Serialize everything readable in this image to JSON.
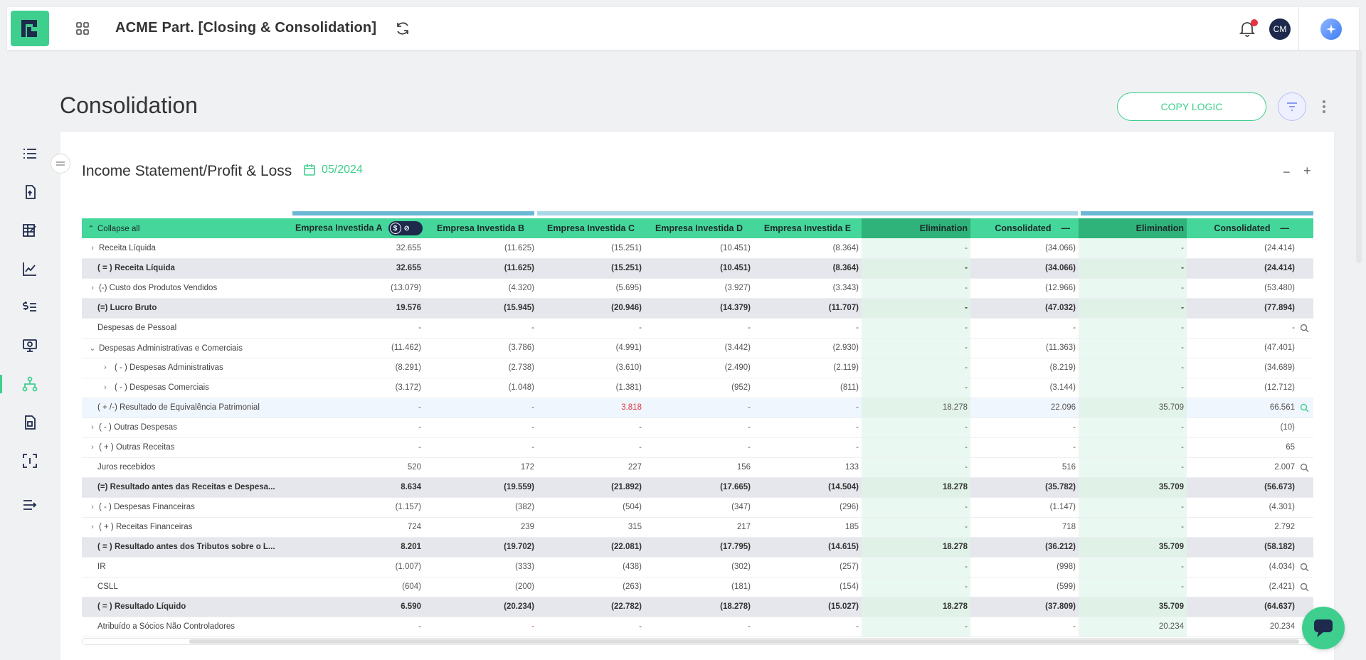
{
  "app": {
    "title": "ACME Part. [Closing & Consolidation]",
    "user_initials": "CM"
  },
  "page": {
    "title": "Consolidation",
    "copy_logic_label": "COPY LOGIC"
  },
  "report": {
    "title": "Income Statement/Profit & Loss",
    "period": "05/2024",
    "collapse_all_label": "Collapse all"
  },
  "colors": {
    "accent": "#3ecf8e",
    "header_bg": "#44d69a",
    "elimination_bg": "#e9f8f0",
    "subtotal_bg": "#e5e7ec",
    "negative": "#e5333f"
  },
  "columns": [
    "Empresa Investida A",
    "Empresa Investida B",
    "Empresa Investida C",
    "Empresa Investida D",
    "Empresa Investida E",
    "Elimination",
    "Consolidated",
    "Elimination",
    "Consolidated"
  ],
  "rows": [
    {
      "label": "Receita Líquida",
      "values": [
        "32.655",
        "(11.625)",
        "(15.251)",
        "(10.451)",
        "(8.364)",
        "-",
        "(34.066)",
        "-",
        "(24.414)"
      ]
    },
    {
      "label": "( = ) Receita Líquida",
      "values": [
        "32.655",
        "(11.625)",
        "(15.251)",
        "(10.451)",
        "(8.364)",
        "-",
        "(34.066)",
        "-",
        "(24.414)"
      ]
    },
    {
      "label": "(-) Custo dos Produtos Vendidos",
      "values": [
        "(13.079)",
        "(4.320)",
        "(5.695)",
        "(3.927)",
        "(3.343)",
        "-",
        "(12.966)",
        "-",
        "(53.480)"
      ]
    },
    {
      "label": "(=) Lucro Bruto",
      "values": [
        "19.576",
        "(15.945)",
        "(20.946)",
        "(14.379)",
        "(11.707)",
        "-",
        "(47.032)",
        "-",
        "(77.894)"
      ]
    },
    {
      "label": "Despesas de Pessoal",
      "values": [
        "-",
        "-",
        "-",
        "-",
        "-",
        "-",
        "-",
        "-",
        "-"
      ]
    },
    {
      "label": "Despesas Administrativas e Comerciais",
      "values": [
        "(11.462)",
        "(3.786)",
        "(4.991)",
        "(3.442)",
        "(2.930)",
        "-",
        "(11.363)",
        "-",
        "(47.401)"
      ]
    },
    {
      "label": "( - ) Despesas Administrativas",
      "values": [
        "(8.291)",
        "(2.738)",
        "(3.610)",
        "(2.490)",
        "(2.119)",
        "-",
        "(8.219)",
        "-",
        "(34.689)"
      ]
    },
    {
      "label": "( - ) Despesas Comerciais",
      "values": [
        "(3.172)",
        "(1.048)",
        "(1.381)",
        "(952)",
        "(811)",
        "-",
        "(3.144)",
        "-",
        "(12.712)"
      ]
    },
    {
      "label": "( + /-) Resultado de Equivalência Patrimonial",
      "values": [
        "-",
        "-",
        "3.818",
        "-",
        "-",
        "18.278",
        "22.096",
        "35.709",
        "66.561"
      ]
    },
    {
      "label": "( - ) Outras Despesas",
      "values": [
        "-",
        "-",
        "-",
        "-",
        "-",
        "-",
        "-",
        "-",
        "(10)"
      ]
    },
    {
      "label": "( + ) Outras Receitas",
      "values": [
        "-",
        "-",
        "-",
        "-",
        "-",
        "-",
        "-",
        "-",
        "65"
      ]
    },
    {
      "label": "Juros recebidos",
      "values": [
        "520",
        "172",
        "227",
        "156",
        "133",
        "-",
        "516",
        "-",
        "2.007"
      ]
    },
    {
      "label": "(=) Resultado antes das Receitas e Despesa...",
      "values": [
        "8.634",
        "(19.559)",
        "(21.892)",
        "(17.665)",
        "(14.504)",
        "18.278",
        "(35.782)",
        "35.709",
        "(56.673)"
      ]
    },
    {
      "label": "( - ) Despesas Financeiras",
      "values": [
        "(1.157)",
        "(382)",
        "(504)",
        "(347)",
        "(296)",
        "-",
        "(1.147)",
        "-",
        "(4.301)"
      ]
    },
    {
      "label": "( + ) Receitas Financeiras",
      "values": [
        "724",
        "239",
        "315",
        "217",
        "185",
        "-",
        "718",
        "-",
        "2.792"
      ]
    },
    {
      "label": "( = ) Resultado antes dos Tributos sobre o L...",
      "values": [
        "8.201",
        "(19.702)",
        "(22.081)",
        "(17.795)",
        "(14.615)",
        "18.278",
        "(36.212)",
        "35.709",
        "(58.182)"
      ]
    },
    {
      "label": "IR",
      "values": [
        "(1.007)",
        "(333)",
        "(438)",
        "(302)",
        "(257)",
        "-",
        "(998)",
        "-",
        "(4.034)"
      ]
    },
    {
      "label": "CSLL",
      "values": [
        "(604)",
        "(200)",
        "(263)",
        "(181)",
        "(154)",
        "-",
        "(599)",
        "-",
        "(2.421)"
      ]
    },
    {
      "label": "( = ) Resultado Líquido",
      "values": [
        "6.590",
        "(20.234)",
        "(22.782)",
        "(18.278)",
        "(15.027)",
        "18.278",
        "(37.809)",
        "35.709",
        "(64.637)"
      ]
    },
    {
      "label": "Atribuído a Sócios Não Controladores",
      "values": [
        "-",
        "-",
        "-",
        "-",
        "-",
        "-",
        "-",
        "20.234",
        "20.234"
      ]
    }
  ]
}
